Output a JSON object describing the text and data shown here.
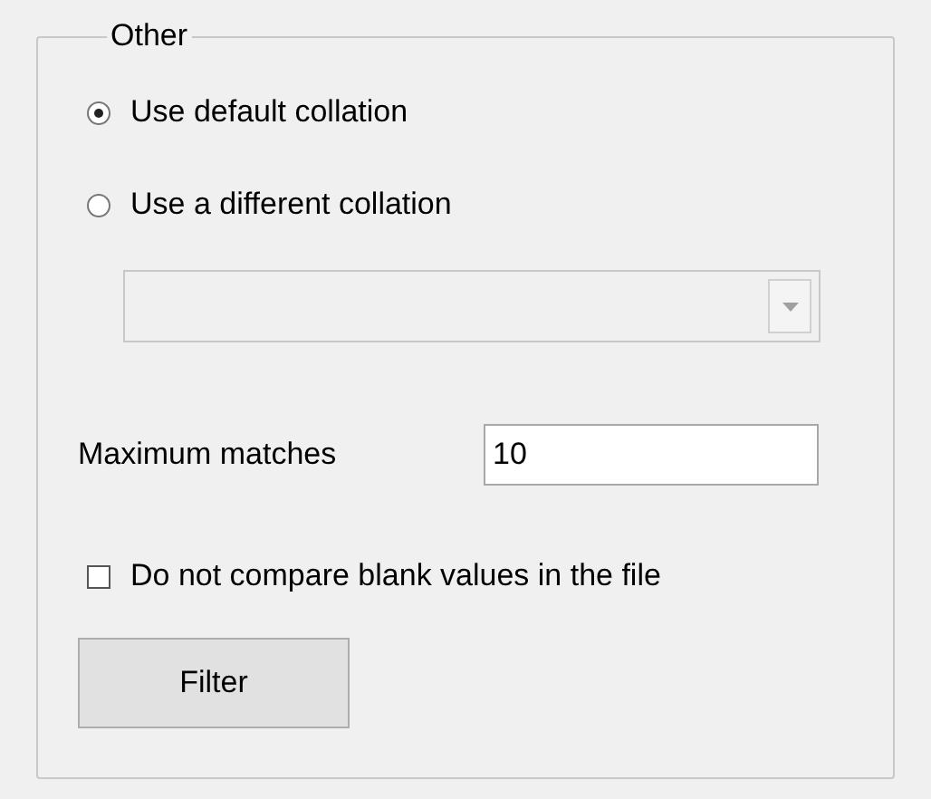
{
  "group": {
    "title": "Other"
  },
  "collation_options": [
    {
      "label": "Use default collation",
      "selected": true
    },
    {
      "label": "Use a different collation",
      "selected": false
    }
  ],
  "collation_dropdown": {
    "disabled": true
  },
  "maximum_matches": {
    "label": "Maximum matches",
    "value": "10"
  },
  "skip_blank_values": {
    "label": "Do not compare blank values in the file",
    "checked": false
  },
  "buttons": [
    "Filter"
  ]
}
